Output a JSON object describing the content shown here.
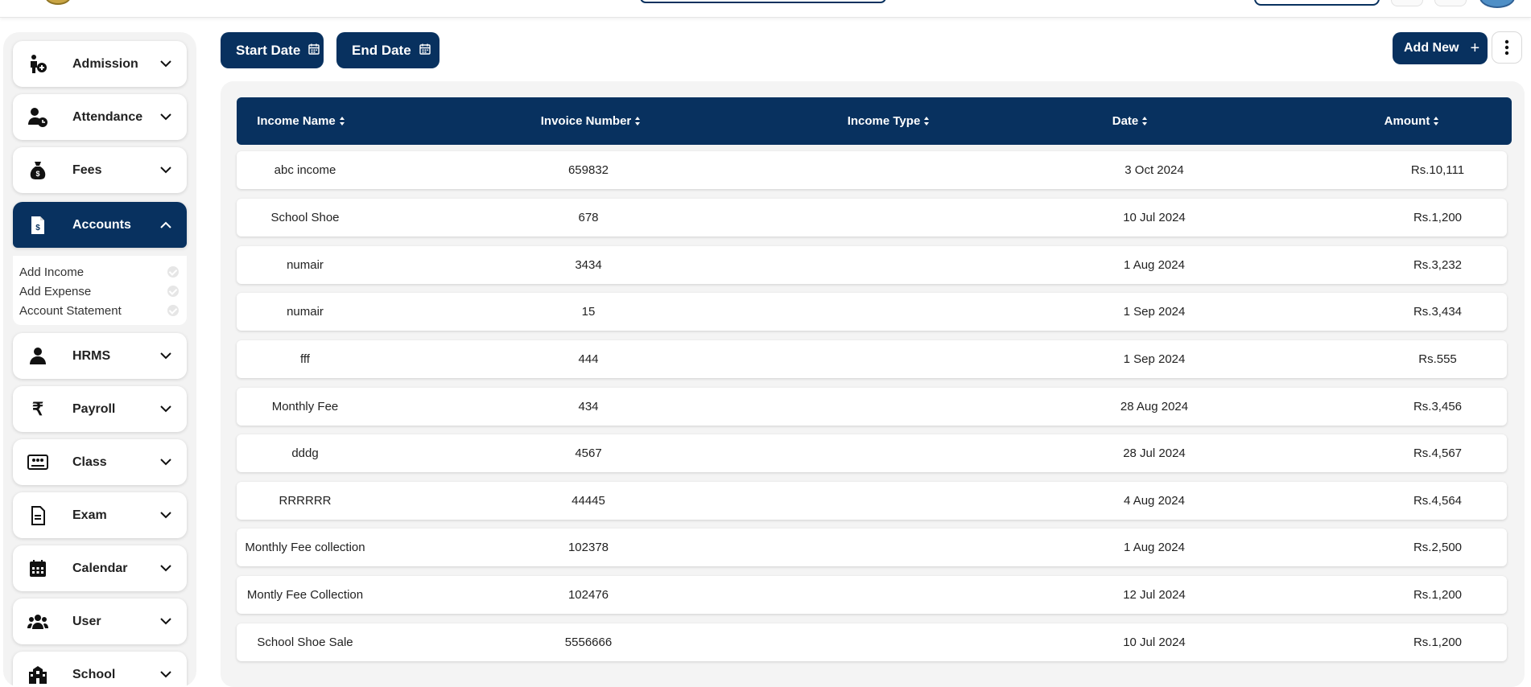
{
  "sidebar": {
    "items": [
      {
        "label": "Admission",
        "icon": "admission-icon",
        "expanded": false
      },
      {
        "label": "Attendance",
        "icon": "attendance-icon",
        "expanded": false
      },
      {
        "label": "Fees",
        "icon": "money-bag-icon",
        "expanded": false
      },
      {
        "label": "Accounts",
        "icon": "invoice-icon",
        "expanded": true
      },
      {
        "label": "HRMS",
        "icon": "person-icon",
        "expanded": false
      },
      {
        "label": "Payroll",
        "icon": "rupee-icon",
        "expanded": false
      },
      {
        "label": "Class",
        "icon": "classroom-icon",
        "expanded": false
      },
      {
        "label": "Exam",
        "icon": "document-icon",
        "expanded": false
      },
      {
        "label": "Calendar",
        "icon": "calendar-icon",
        "expanded": false
      },
      {
        "label": "User",
        "icon": "users-icon",
        "expanded": false
      },
      {
        "label": "School",
        "icon": "school-icon",
        "expanded": false
      }
    ],
    "accounts_submenu": [
      "Add Income",
      "Add Expense",
      "Account Statement"
    ]
  },
  "toolbar": {
    "start_date_label": "Start Date",
    "end_date_label": "End Date",
    "add_new_label": "Add New",
    "add_new_icon": "+"
  },
  "table": {
    "columns": [
      "Income Name",
      "Invoice Number",
      "Income Type",
      "Date",
      "Amount"
    ],
    "rows": [
      [
        "abc income",
        "659832",
        "",
        "3 Oct 2024",
        "Rs.10,111"
      ],
      [
        "School Shoe",
        "678",
        "",
        "10 Jul 2024",
        "Rs.1,200"
      ],
      [
        "numair",
        "3434",
        "",
        "1 Aug 2024",
        "Rs.3,232"
      ],
      [
        "numair",
        "15",
        "",
        "1 Sep 2024",
        "Rs.3,434"
      ],
      [
        "fff",
        "444",
        "",
        "1 Sep 2024",
        "Rs.555"
      ],
      [
        "Monthly Fee",
        "434",
        "",
        "28 Aug 2024",
        "Rs.3,456"
      ],
      [
        "dddg",
        "4567",
        "",
        "28 Jul 2024",
        "Rs.4,567"
      ],
      [
        "RRRRRR",
        "44445",
        "",
        "4 Aug 2024",
        "Rs.4,564"
      ],
      [
        "Monthly Fee collection",
        "102378",
        "",
        "1 Aug 2024",
        "Rs.2,500"
      ],
      [
        "Montly Fee Collection",
        "102476",
        "",
        "12 Jul 2024",
        "Rs.1,200"
      ],
      [
        "School Shoe Sale",
        "5556666",
        "",
        "10 Jul 2024",
        "Rs.1,200"
      ]
    ]
  },
  "colors": {
    "primary": "#08315f",
    "panel": "#f4f4f4"
  }
}
